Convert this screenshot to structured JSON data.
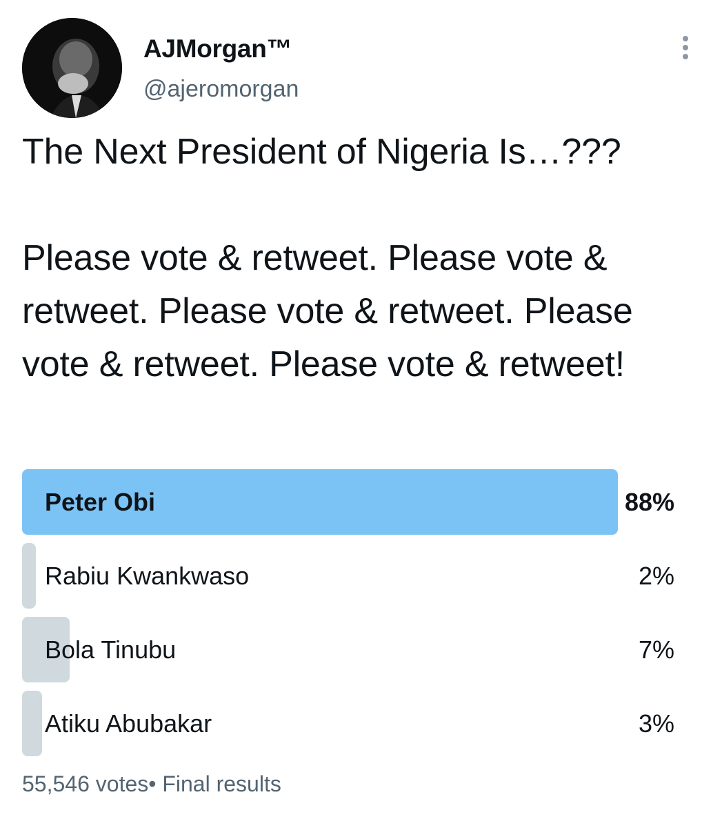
{
  "tweet": {
    "author": {
      "display_name": "AJMorgan™",
      "handle": "@ajeromorgan"
    },
    "text": "The Next President of Nigeria Is…???\n\nPlease vote & retweet. Please vote & retweet. Please vote & retweet. Please vote & retweet. Please vote & retweet!"
  },
  "poll": {
    "options": [
      {
        "label": "Peter Obi",
        "percent_text": "88%",
        "percent": 88,
        "winner": true
      },
      {
        "label": "Rabiu Kwankwaso",
        "percent_text": "2%",
        "percent": 2,
        "winner": false
      },
      {
        "label": "Bola Tinubu",
        "percent_text": "7%",
        "percent": 7,
        "winner": false
      },
      {
        "label": "Atiku Abubakar",
        "percent_text": "3%",
        "percent": 3,
        "winner": false
      }
    ],
    "footer": "55,546 votes• Final results"
  },
  "colors": {
    "winner_bar": "#7cc3f5",
    "option_bar": "#cfd9de",
    "secondary_text": "#536471"
  },
  "icons": {
    "more": "more-vertical-icon",
    "avatar": "profile-photo"
  }
}
